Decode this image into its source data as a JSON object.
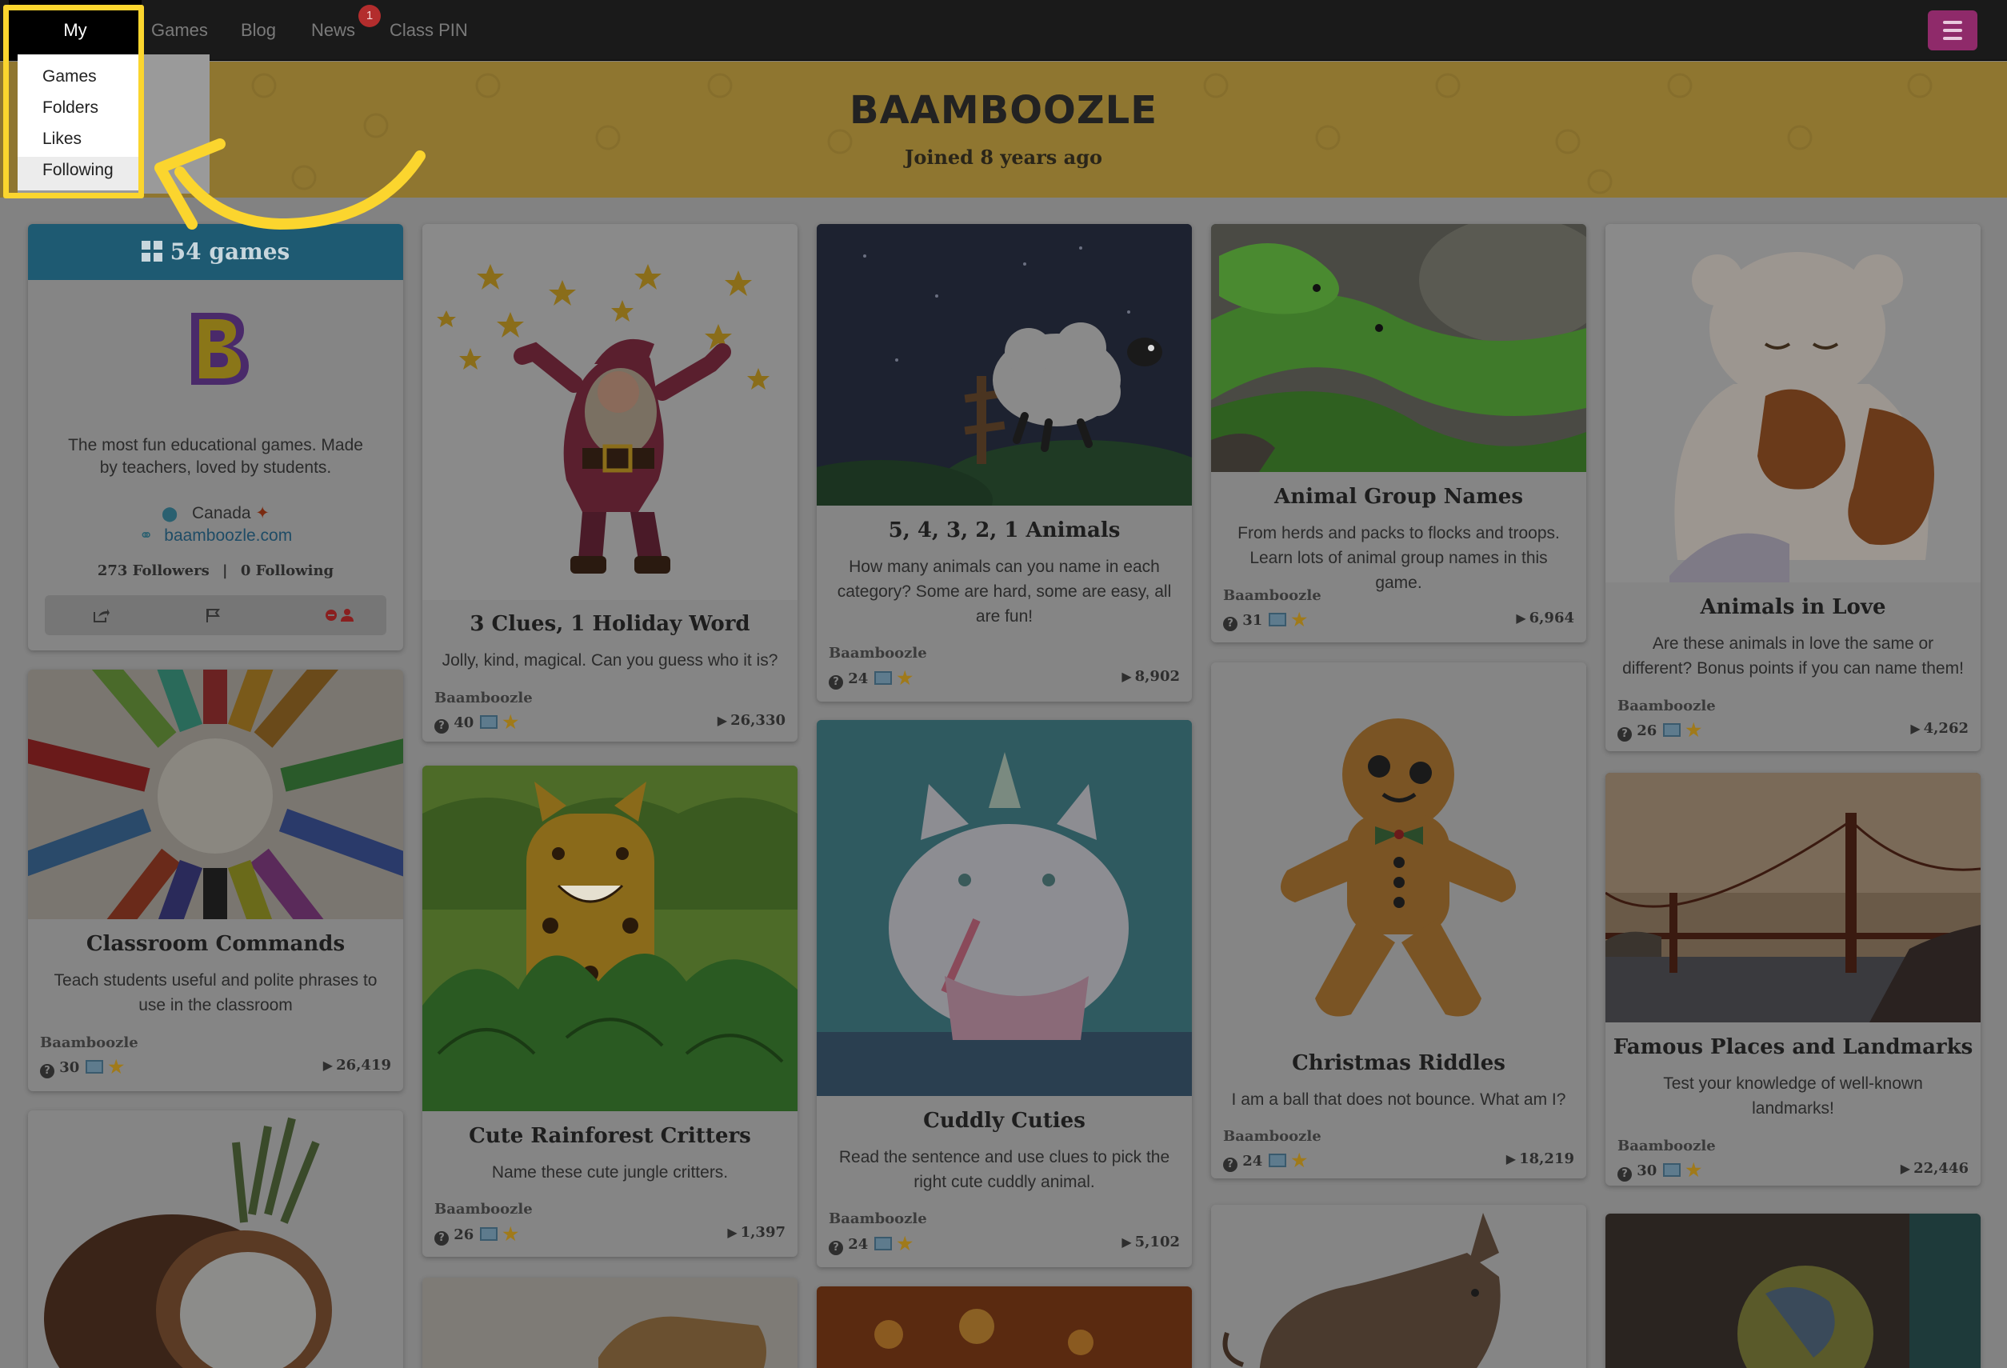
{
  "nav": {
    "items": [
      "My Library",
      "Games",
      "Blog",
      "News",
      "Class PIN"
    ],
    "news_badge": "1"
  },
  "dropdown": {
    "items": [
      "Games",
      "Folders",
      "Likes",
      "Following"
    ]
  },
  "banner": {
    "brand": "BAAMBOOZLE",
    "joined": "Joined 8 years ago"
  },
  "profile": {
    "games_count": "54 games",
    "logo_letter": "B",
    "bio": "The most fun educational games. Made by teachers, loved by students.",
    "location": "Canada",
    "website": "baamboozle.com",
    "followers": "273 Followers",
    "following": "0 Following"
  },
  "cards": [
    {
      "title": "3 Clues, 1 Holiday Word",
      "desc": "Jolly, kind, magical. Can you guess who it is?",
      "author": "Baamboozle",
      "questions": "40",
      "plays": "26,330"
    },
    {
      "title": "5, 4, 3, 2, 1 Animals",
      "desc": "How many animals can you name in each category? Some are hard, some are easy, all are fun!",
      "author": "Baamboozle",
      "questions": "24",
      "plays": "8,902"
    },
    {
      "title": "Animal Group Names",
      "desc": "From herds and packs to flocks and troops. Learn lots of animal group names in this game.",
      "author": "Baamboozle",
      "questions": "31",
      "plays": "6,964"
    },
    {
      "title": "Animals in Love",
      "desc": "Are these animals in love the same or different? Bonus points if you can name them!",
      "author": "Baamboozle",
      "questions": "26",
      "plays": "4,262"
    },
    {
      "title": "Classroom Commands",
      "desc": "Teach students useful and polite phrases to use in the classroom",
      "author": "Baamboozle",
      "questions": "30",
      "plays": "26,419"
    },
    {
      "title": "Cute Rainforest Critters",
      "desc": "Name these cute jungle critters.",
      "author": "Baamboozle",
      "questions": "26",
      "plays": "1,397"
    },
    {
      "title": "Cuddly Cuties",
      "desc": "Read the sentence and use clues to pick the right cute cuddly animal.",
      "author": "Baamboozle",
      "questions": "24",
      "plays": "5,102"
    },
    {
      "title": "Christmas Riddles",
      "desc": "I am a ball that does not bounce. What am I?",
      "author": "Baamboozle",
      "questions": "24",
      "plays": "18,219"
    },
    {
      "title": "Famous Places and Landmarks",
      "desc": "Test your knowledge of well-known landmarks!",
      "author": "Baamboozle",
      "questions": "30",
      "plays": "22,446"
    }
  ],
  "colors": {
    "highlight": "#fbd52e",
    "profile_header": "#1e5a72",
    "menu_button": "#8f2a6a",
    "banner": "#8f7630"
  }
}
